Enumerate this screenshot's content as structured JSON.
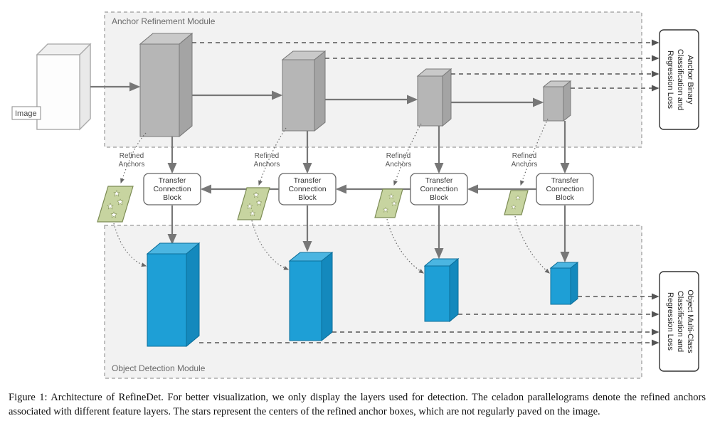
{
  "figure_number": "Figure 1:",
  "caption_rest": "Architecture of RefineDet. For better visualization, we only display the layers used for detection. The celadon parallelograms denote the refined anchors associated with different feature layers. The stars represent the centers of the refined anchor boxes, which are not regularly paved on the image.",
  "modules": {
    "arm": "Anchor Refinement Module",
    "odm": "Object Detection Module"
  },
  "image_label": "Image",
  "tcb_label_line1": "Transfer",
  "tcb_label_line2": "Connection",
  "tcb_label_line3": "Block",
  "refined_label_line1": "Refined",
  "refined_label_line2": "Anchors",
  "loss_arm_line1": "Anchor Binary",
  "loss_arm_line2": "Classification and",
  "loss_arm_line3": "Regression Loss",
  "loss_odm_line1": "Object Multi-Class",
  "loss_odm_line2": "Classification and",
  "loss_odm_line3": "Regression Loss"
}
